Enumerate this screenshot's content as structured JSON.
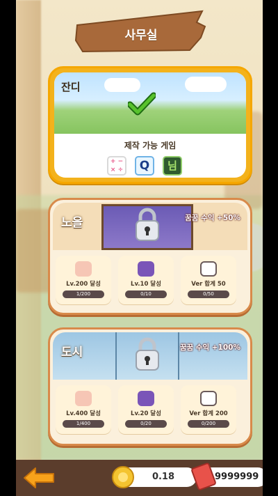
{
  "header": {
    "title": "사무실"
  },
  "locations": [
    {
      "name": "잔디",
      "status": "unlocked",
      "caption": "제작 가능 게임",
      "games": [
        {
          "icon": "math-symbols-icon",
          "text": "+ − × ÷"
        },
        {
          "icon": "letter-q-icon",
          "text": "Q"
        },
        {
          "icon": "korean-letter-icon",
          "text": "님"
        }
      ]
    },
    {
      "name": "노을",
      "status": "locked",
      "bonus": "꿈꿈 수익 +50%",
      "requirements": [
        {
          "icon": "paw-icon",
          "label": "Lv.200 달성",
          "progress": "1/200"
        },
        {
          "icon": "monitor-icon",
          "label": "Lv.10 달성",
          "progress": "0/10"
        },
        {
          "icon": "gamepad-icon",
          "label": "Ver 합계 50",
          "progress": "0/50"
        }
      ]
    },
    {
      "name": "도시",
      "status": "locked",
      "bonus": "꿈꿈 수익 +100%",
      "requirements": [
        {
          "icon": "paw-icon",
          "label": "Lv.400 달성",
          "progress": "1/400"
        },
        {
          "icon": "monitor-icon",
          "label": "Lv.20 달성",
          "progress": "0/20"
        },
        {
          "icon": "gamepad-icon",
          "label": "Ver 합계 200",
          "progress": "0/200"
        }
      ]
    }
  ],
  "footer": {
    "coins": "0.18",
    "tickets": "9999999"
  },
  "colors": {
    "accent": "#f3b21c",
    "card_border": "#d88a4a",
    "bar": "#5b3d2c"
  }
}
